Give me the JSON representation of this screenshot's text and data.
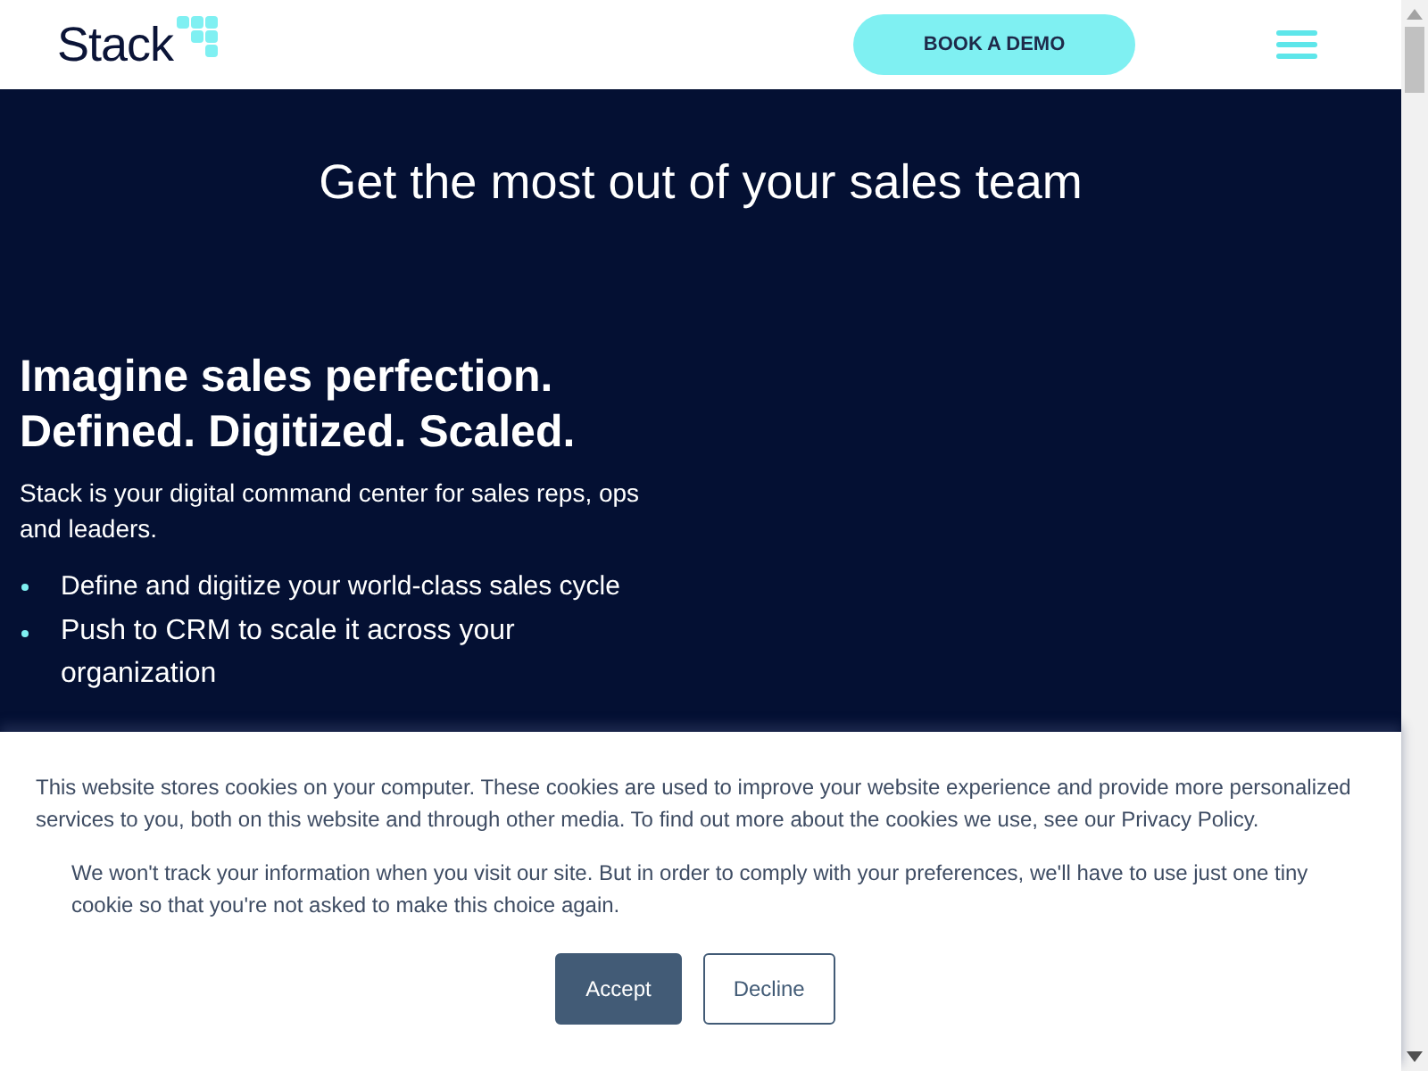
{
  "header": {
    "logo": "Stack",
    "button": "BOOK A DEMO"
  },
  "hero": {
    "title": "Get the most out of your sales team",
    "headline_lines": [
      "Imagine sales perfection.",
      "Defined. Digitized. Scaled."
    ],
    "description": "Stack is your digital command center for sales reps, ops and leaders.",
    "bullets": [
      "Define and digitize your world-class sales cycle",
      "Push to CRM to scale it across your organization"
    ]
  },
  "cookie_banner": {
    "paragraphs": [
      "This website stores cookies on your computer. These cookies are used to improve your website experience and provide more personalized services to you, both on this website and through other media. To find out more about the cookies we use, see our Privacy Policy.",
      "We won't track your information when you visit our site. But in order to comply with your preferences, we'll have to use just one tiny cookie so that you're not asked to make this choice again."
    ],
    "buttons": [
      {
        "label": "Accept",
        "kind": "primary"
      },
      {
        "label": "Decline",
        "kind": "secondary"
      }
    ]
  }
}
